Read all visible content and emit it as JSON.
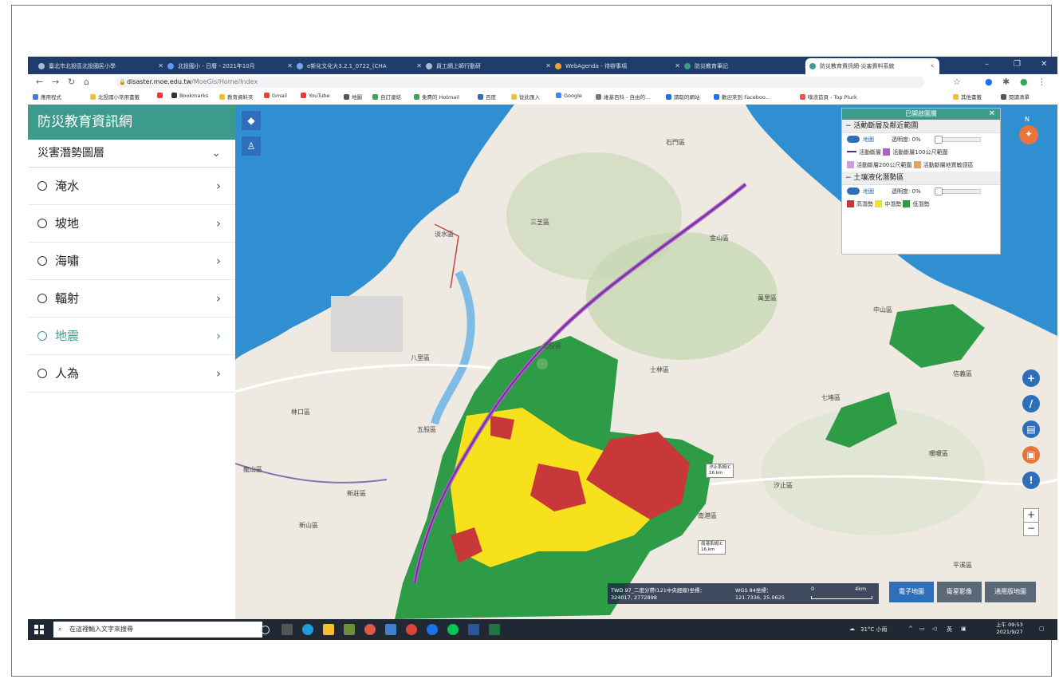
{
  "browser": {
    "tabs": [
      {
        "label": "臺北市北投區北投國民小學"
      },
      {
        "label": "北投國小 - 日曆 - 2021年10月"
      },
      {
        "label": "e新化文化大3.2.1_0722_(CHA"
      },
      {
        "label": "員工網上師行動研"
      },
      {
        "label": "WebAgenda - 待辦事項"
      },
      {
        "label": "防災教育筆記"
      },
      {
        "label": "防災教育資訊網-災害資料系統"
      }
    ],
    "new_tab": "+",
    "window_controls": [
      "–",
      "❐",
      "✕"
    ],
    "url_domain": "disaster.moe.edu.tw",
    "url_path": "/MoeGis/Home/Index",
    "bookmarks": [
      "應用程式",
      "北投國小常用書籤",
      "Bookmarks",
      "教育資料夾",
      "Gmail",
      "YouTube",
      "地圖",
      "自訂連結",
      "免費的 Hotmail",
      "百度",
      "從此匯入",
      "Google",
      "維基百科 - 自由的...",
      "讀取的網站",
      "歡迎來到 Faceboo...",
      "噗浪首頁 - Top Plurk",
      "其他書籤",
      "閱讀清單"
    ]
  },
  "sidebar": {
    "title": "防災教育資訊網",
    "section": "災害潛勢圖層",
    "items": [
      {
        "label": "淹水"
      },
      {
        "label": "坡地"
      },
      {
        "label": "海嘯"
      },
      {
        "label": "輻射"
      },
      {
        "label": "地震"
      },
      {
        "label": "人為"
      }
    ],
    "active_item": "地震"
  },
  "legend": {
    "title": "已開啟圖層",
    "close": "✕",
    "fault_section": "活動斷層及鄰近範圍",
    "fault_visibility": "地圖",
    "fault_opacity": "透明度: 0%",
    "fault_items": [
      "活動斷層",
      "活動斷層100公尺範圍",
      "活動斷層200公尺範圍",
      "活動斷層地質敏感區"
    ],
    "liquefaction_section": "土壤液化潛勢區",
    "liq_visibility": "地圖",
    "liq_opacity": "透明度: 0%",
    "liq_items": [
      "高潛勢",
      "中潛勢",
      "低潛勢"
    ],
    "colors": {
      "fault": "#5a2d8c",
      "fault100": "#b05cc9",
      "fault200": "#c9a0dc",
      "sensitive": "#d9a56b",
      "high": "#c8373a",
      "mid": "#f6e11c",
      "low": "#2e9b47"
    }
  },
  "map_labels": [
    "石門區",
    "三芝區",
    "金山區",
    "淡水區",
    "萬里區",
    "北投區",
    "士林區",
    "八里區",
    "林口區",
    "五股區",
    "中山區",
    "七堵區",
    "信義區",
    "暖暖區",
    "汐止區",
    "南港區",
    "平溪區",
    "新莊區",
    "新山區",
    "龍山區"
  ],
  "highway_labels": [
    "汐止系統IC\n16.km",
    "南港系統IC\n16.km"
  ],
  "coordinates": {
    "twd_label": "TWD 97_二度分帶(121中央經線)坐標：",
    "twd_value": "324017, 2772898",
    "wgs_label": "WGS 84坐標：",
    "wgs_value": "121.7336, 25.0625",
    "scale_start": "0",
    "scale_end": "4km"
  },
  "base_maps": [
    "電子地圖",
    "衛星影像",
    "通用版地圖"
  ],
  "compass": "N",
  "zoom": {
    "in": "+",
    "out": "−"
  },
  "taskbar": {
    "search_placeholder": "在這裡輸入文字來搜尋",
    "weather": "31°C 小雨",
    "lang": "英",
    "time": "上午 09:53",
    "date": "2021/9/27"
  }
}
